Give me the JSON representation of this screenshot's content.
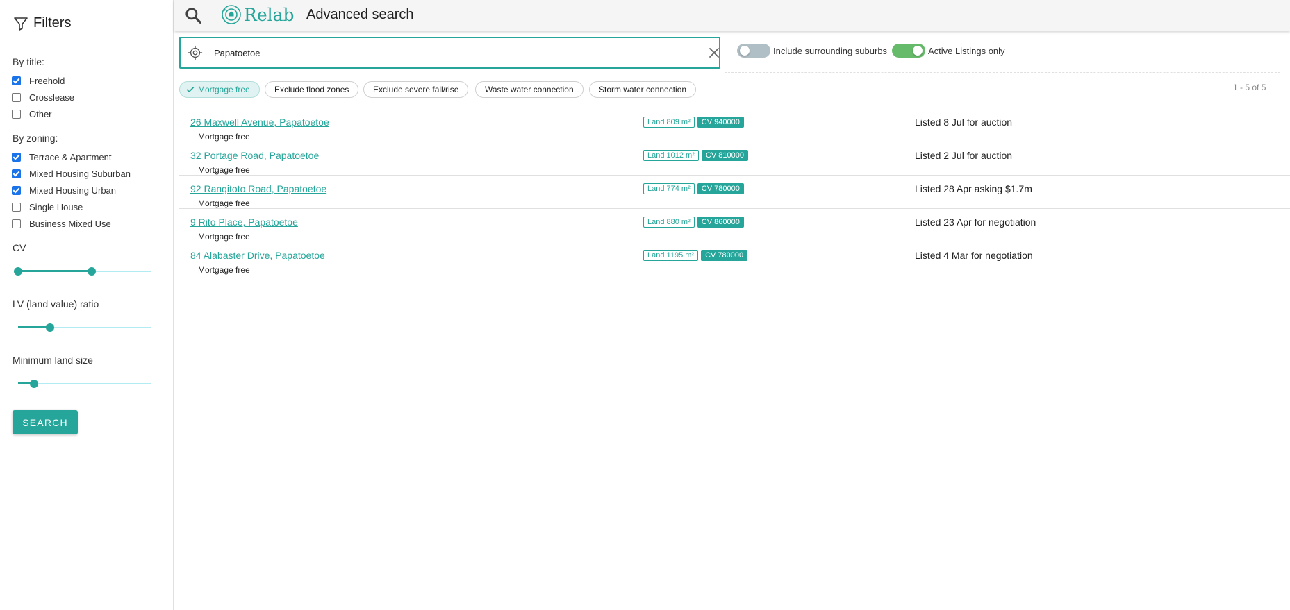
{
  "header": {
    "title": "Advanced search",
    "logo_text": "Relab"
  },
  "sidebar": {
    "title": "Filters",
    "by_title_label": "By title:",
    "title_options": [
      {
        "label": "Freehold",
        "checked": true
      },
      {
        "label": "Crosslease",
        "checked": false
      },
      {
        "label": "Other",
        "checked": false
      }
    ],
    "by_zoning_label": "By zoning:",
    "zoning_options": [
      {
        "label": "Terrace & Apartment",
        "checked": true
      },
      {
        "label": "Mixed Housing Suburban",
        "checked": true
      },
      {
        "label": "Mixed Housing Urban",
        "checked": true
      },
      {
        "label": "Single House",
        "checked": false
      },
      {
        "label": "Business Mixed Use",
        "checked": false
      }
    ],
    "cv_label": "CV",
    "cv_range": [
      0.0,
      0.55
    ],
    "lv_label": "LV (land value) ratio",
    "lv_value": 0.24,
    "min_land_label": "Minimum land size",
    "min_land_value": 0.12,
    "search_label": "SEARCH"
  },
  "location": {
    "value": "Papatoetoe"
  },
  "toggles": {
    "surrounding_label": "Include surrounding suburbs",
    "surrounding_on": false,
    "active_label": "Active Listings only",
    "active_on": true
  },
  "chips": [
    {
      "label": "Mortgage free",
      "active": true
    },
    {
      "label": "Exclude flood zones",
      "active": false
    },
    {
      "label": "Exclude severe fall/rise",
      "active": false
    },
    {
      "label": "Waste water connection",
      "active": false
    },
    {
      "label": "Storm water connection",
      "active": false
    }
  ],
  "results_count": "1 - 5 of 5",
  "results": [
    {
      "address": "26 Maxwell Avenue, Papatoetoe",
      "tag": "Mortgage free",
      "land": "Land 809 m²",
      "cv": "CV 940000",
      "listed": "Listed 8 Jul for auction"
    },
    {
      "address": "32 Portage Road, Papatoetoe",
      "tag": "Mortgage free",
      "land": "Land 1012 m²",
      "cv": "CV 810000",
      "listed": "Listed 2 Jul for auction"
    },
    {
      "address": "92 Rangitoto Road, Papatoetoe",
      "tag": "Mortgage free",
      "land": "Land 774 m²",
      "cv": "CV 780000",
      "listed": "Listed 28 Apr asking $1.7m"
    },
    {
      "address": "9 Rito Place, Papatoetoe",
      "tag": "Mortgage free",
      "land": "Land 880 m²",
      "cv": "CV 860000",
      "listed": "Listed 23 Apr for negotiation"
    },
    {
      "address": "84 Alabaster Drive, Papatoetoe",
      "tag": "Mortgage free",
      "land": "Land 1195 m²",
      "cv": "CV 780000",
      "listed": "Listed 4 Mar for negotiation"
    }
  ],
  "colors": {
    "accent": "#26a69a",
    "checkbox": "#1a73e8",
    "toggle_on": "#66bb6a",
    "toggle_off": "#b0bec5"
  },
  "icons": {
    "filter": "filter-icon",
    "search": "search-icon",
    "logo": "relab-logo-icon",
    "location": "crosshair-icon",
    "clear": "close-icon",
    "check": "check-icon"
  }
}
